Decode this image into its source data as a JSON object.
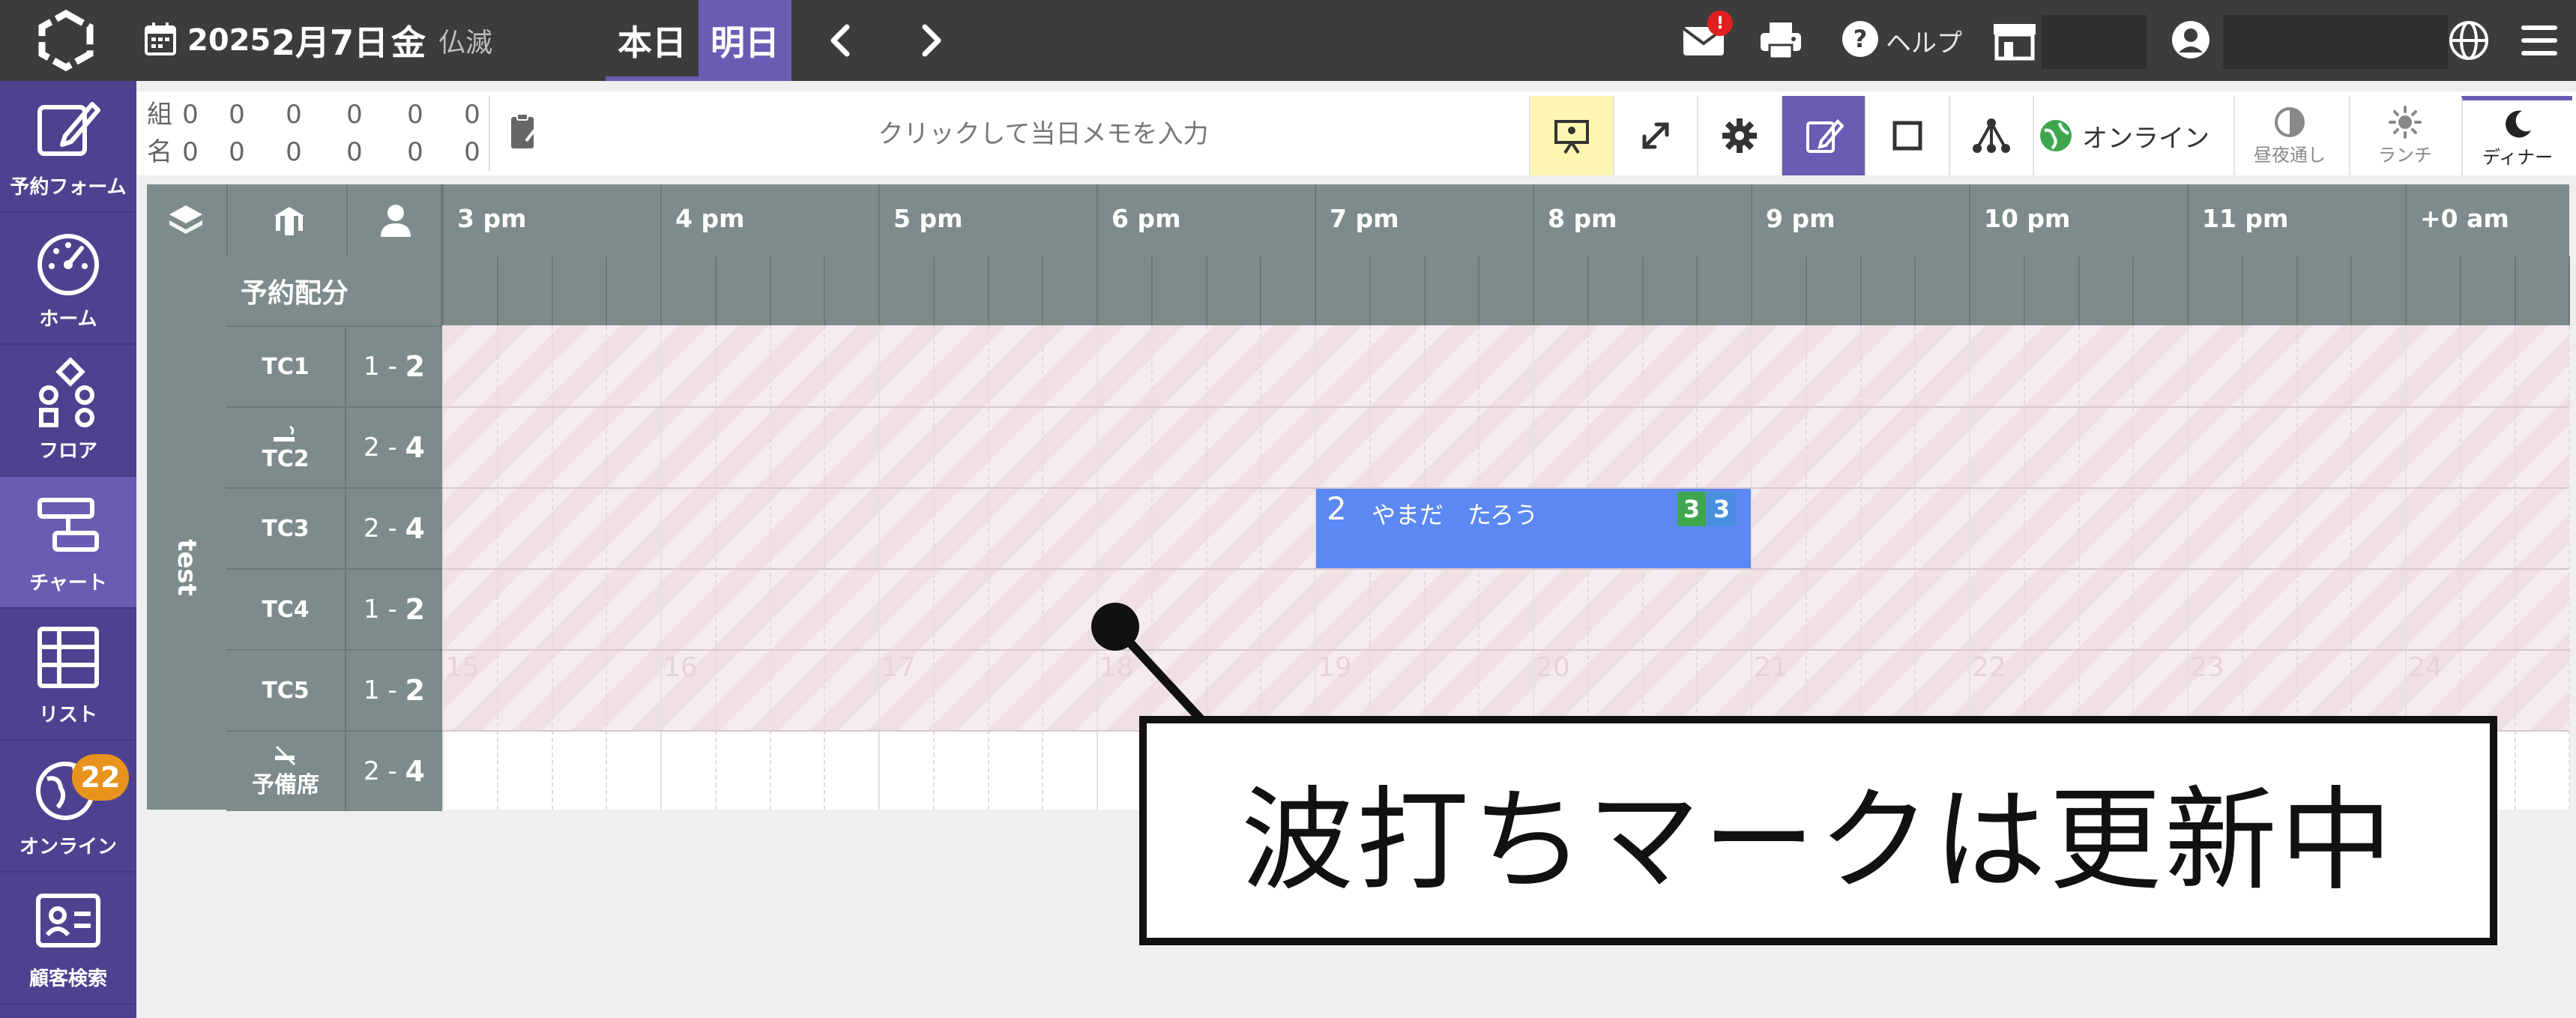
{
  "header": {
    "date_year": "2025",
    "date_month_day": "2月7日",
    "date_weekday": "金",
    "date_rokuyo": "仏滅",
    "today_label": "本日",
    "tomorrow_label": "明日",
    "mail_badge": "!",
    "help_label": "ヘルプ"
  },
  "sidebar": {
    "items": [
      {
        "label": "予約フォーム"
      },
      {
        "label": "ホーム"
      },
      {
        "label": "フロア"
      },
      {
        "label": "チャート"
      },
      {
        "label": "リスト"
      },
      {
        "label": "オンライン",
        "badge": "22"
      },
      {
        "label": "顧客検索"
      }
    ]
  },
  "toolbar": {
    "stats_row1": [
      "組",
      "0",
      "0",
      "0",
      "0",
      "0",
      "0"
    ],
    "stats_row2": [
      "名",
      "0",
      "0",
      "0",
      "0",
      "0",
      "0"
    ],
    "memo_placeholder": "クリックして当日メモを入力",
    "online_label": "オンライン",
    "mode_allday": "昼夜通し",
    "mode_lunch": "ランチ",
    "mode_dinner": "ディナー"
  },
  "chart": {
    "hours": [
      "3 pm",
      "4 pm",
      "5 pm",
      "6 pm",
      "7 pm",
      "8 pm",
      "9 pm",
      "10 pm",
      "11 pm",
      "+0 am"
    ],
    "alloc_label": "予約配分",
    "group_label": "test",
    "tables": [
      {
        "name": "TC1",
        "cap_min": "1",
        "cap_max": "2"
      },
      {
        "name": "TC2",
        "cap_min": "2",
        "cap_max": "4"
      },
      {
        "name": "TC3",
        "cap_min": "2",
        "cap_max": "4"
      },
      {
        "name": "TC4",
        "cap_min": "1",
        "cap_max": "2"
      },
      {
        "name": "TC5",
        "cap_min": "1",
        "cap_max": "2"
      },
      {
        "name": "予備席",
        "cap_min": "2",
        "cap_max": "4"
      }
    ],
    "watermark_hours": [
      "15",
      "16",
      "17",
      "18",
      "19",
      "20",
      "21",
      "22",
      "23",
      "24"
    ],
    "reservation": {
      "party_size": "2",
      "guest_name": "やまだ　たろう",
      "badge_green": "3",
      "badge_blue": "3"
    }
  },
  "annotation": {
    "text": "波打ちマークは更新中"
  },
  "colors": {
    "topbar": "#3c3c3c",
    "sidebar": "#4e4290",
    "accent": "#6a5cb3",
    "chart_header": "#7e8b8b",
    "reservation": "#5b88f2",
    "badge_green": "#3fa64f",
    "badge_blue": "#4a8fdf",
    "online_badge": "#e8931e"
  }
}
